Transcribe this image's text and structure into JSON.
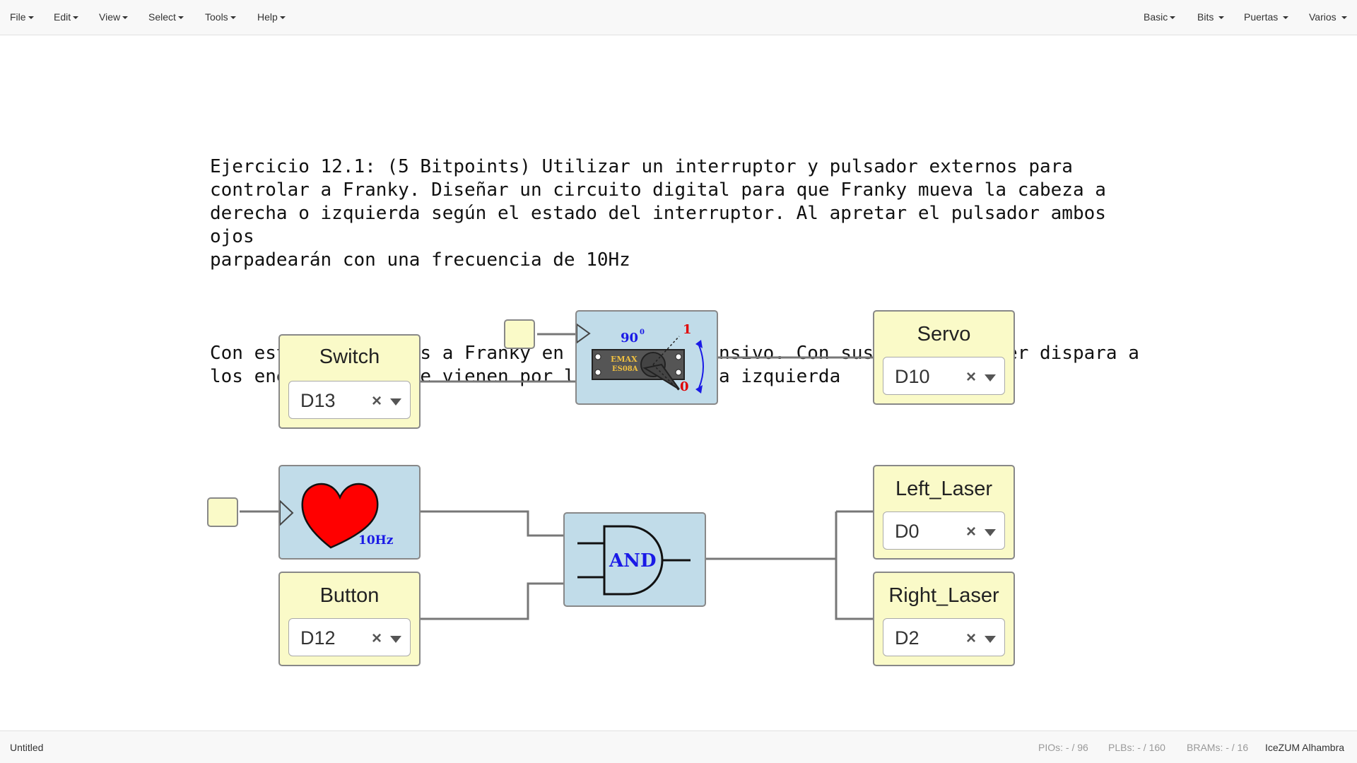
{
  "menu": {
    "left": [
      "File",
      "Edit",
      "View",
      "Select",
      "Tools",
      "Help"
    ],
    "right": [
      "Basic",
      "Bits",
      "Puertas",
      "Varios"
    ]
  },
  "exercise": {
    "paragraph1": "Ejercicio 12.1: (5 Bitpoints) Utilizar un interruptor y pulsador externos para\ncontrolar a Franky. Diseñar un circuito digital para que Franky mueva la cabeza a\nderecha o izquierda según el estado del interruptor. Al apretar el pulsador ambos ojos\nparpadearán con una frecuencia de 10Hz",
    "paragraph2": "Con esto convertimos a Franky en un robot defensivo. Con sus ráfagas láser dispara a\nlos enemigos, que le vienen por la derecha y la izquierda"
  },
  "blocks": {
    "switch": {
      "title": "Switch",
      "pin": "D13",
      "clear": "×"
    },
    "servo": {
      "title": "Servo",
      "pin": "D10",
      "clear": "×"
    },
    "button": {
      "title": "Button",
      "pin": "D12",
      "clear": "×"
    },
    "left_laser": {
      "title": "Left_Laser",
      "pin": "D0",
      "clear": "×"
    },
    "right_laser": {
      "title": "Right_Laser",
      "pin": "D2",
      "clear": "×"
    },
    "servo_module": {
      "angle": "90",
      "degree": "0",
      "label_top": "EMAX",
      "label_bottom": "ES08A",
      "pos_high": "1",
      "pos_low": "0"
    },
    "heart_module": {
      "freq": "10Hz"
    },
    "and_gate": {
      "label": "AND"
    }
  },
  "status": {
    "project": "Untitled",
    "pios": "PIOs: - / 96",
    "plbs": "PLBs: - / 160",
    "brams": "BRAMs: - / 16",
    "board": "IceZUM Alhambra"
  },
  "colors": {
    "io_block_bg": "#fafac8",
    "module_bg": "#c1dce9",
    "heart": "#ff0000",
    "and_text": "#1a1ae6",
    "wire": "#777777"
  }
}
